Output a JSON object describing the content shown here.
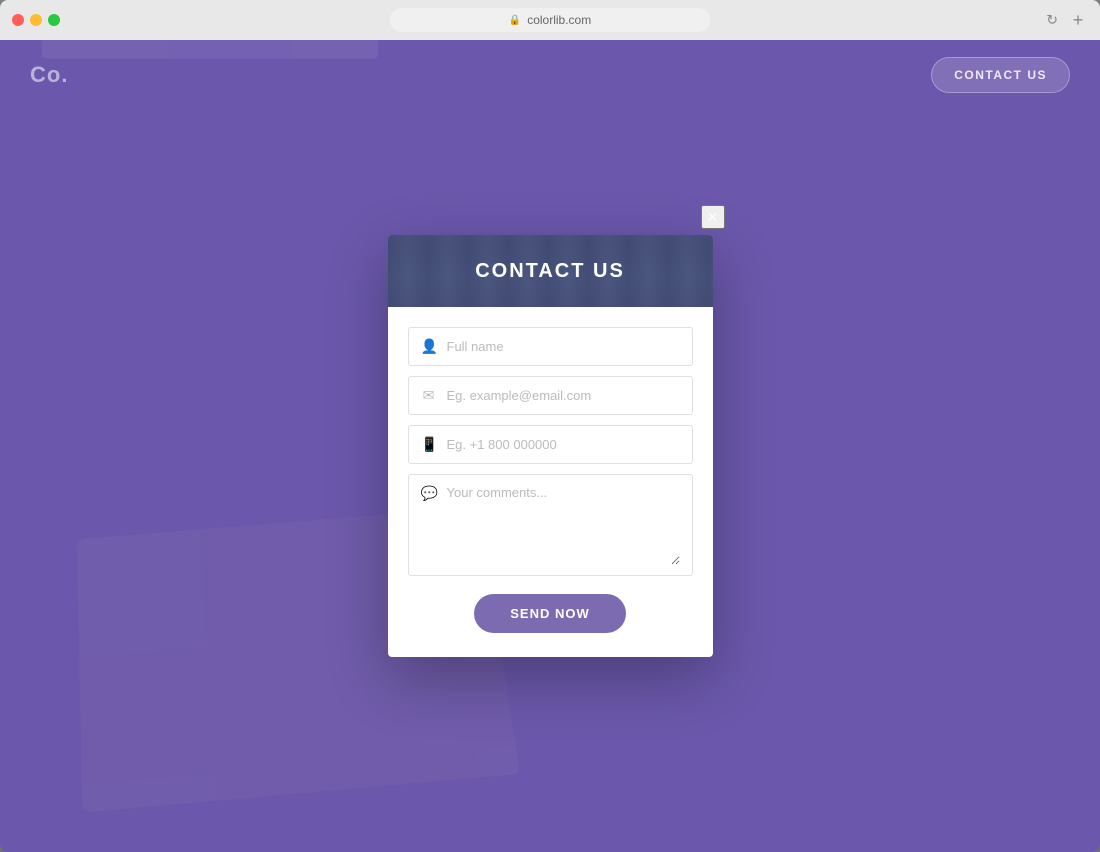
{
  "window": {
    "url": "colorlib.com",
    "new_tab_label": "+"
  },
  "navbar": {
    "logo": "Co.",
    "contact_button_label": "CONTACT US"
  },
  "modal": {
    "close_icon": "×",
    "title": "CONTACT US",
    "form": {
      "name_placeholder": "Full name",
      "email_placeholder": "Eg. example@email.com",
      "phone_placeholder": "Eg. +1 800 000000",
      "comments_placeholder": "Your comments...",
      "submit_label": "SEND NOW"
    }
  },
  "colors": {
    "purple": "#7c6bb0",
    "bg_purple": "#7c6bb0"
  }
}
